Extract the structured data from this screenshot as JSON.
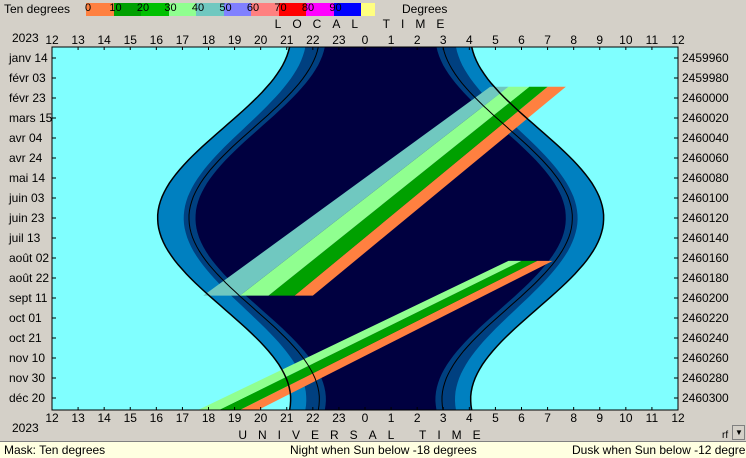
{
  "legend": {
    "title": "Ten degrees",
    "unit": "Degrees",
    "swatches": [
      {
        "label": "0",
        "color": "#ff8040"
      },
      {
        "label": "10",
        "color": "#00a000"
      },
      {
        "label": "20",
        "color": "#00c000"
      },
      {
        "label": "30",
        "color": "#90ff90"
      },
      {
        "label": "40",
        "color": "#70c8c0"
      },
      {
        "label": "50",
        "color": "#8080ff"
      },
      {
        "label": "60",
        "color": "#ff8080"
      },
      {
        "label": "70",
        "color": "#ff0000"
      },
      {
        "label": "80",
        "color": "#ff00ff"
      },
      {
        "label": "90",
        "color": "#0000ff"
      },
      {
        "label": "",
        "color": "#ffff80"
      }
    ]
  },
  "chart_data": {
    "type": "heatmap",
    "title_top": "LOCAL TIME",
    "title_bottom": "UNIVERSAL TIME",
    "year": "2023",
    "x_ticks": [
      "12",
      "13",
      "14",
      "15",
      "16",
      "17",
      "18",
      "19",
      "20",
      "21",
      "22",
      "23",
      "0",
      "1",
      "2",
      "3",
      "4",
      "5",
      "6",
      "7",
      "8",
      "9",
      "10",
      "11",
      "12"
    ],
    "y_date_labels": [
      "janv 14",
      "févr 03",
      "févr 23",
      "mars 15",
      "avr 04",
      "avr 24",
      "mai 14",
      "juin 03",
      "juin 23",
      "juil 13",
      "août 02",
      "août 22",
      "sept 11",
      "oct 01",
      "oct 21",
      "nov 10",
      "nov 30",
      "déc 20"
    ],
    "y_jd_labels": [
      "2459960",
      "2459980",
      "2460000",
      "2460020",
      "2460040",
      "2460060",
      "2460080",
      "2460100",
      "2460120",
      "2460140",
      "2460160",
      "2460180",
      "2460200",
      "2460220",
      "2460240",
      "2460260",
      "2460280",
      "2460300"
    ],
    "colors": {
      "day": "#80ffff",
      "night": "#000040",
      "twilight_dark": "#004080",
      "twilight": "#0080c0",
      "band_0": "#ff8040",
      "band_10": "#00a000",
      "band_20": "#90ff90",
      "band_30": "#70c8c0"
    },
    "night_threshold": "-18 degrees",
    "dusk_threshold": "-12 degrees"
  },
  "status": {
    "mask": "Mask:  Ten degrees",
    "night": "Night when Sun below -18 degrees",
    "dusk": "Dusk when Sun below -12 degrees"
  }
}
